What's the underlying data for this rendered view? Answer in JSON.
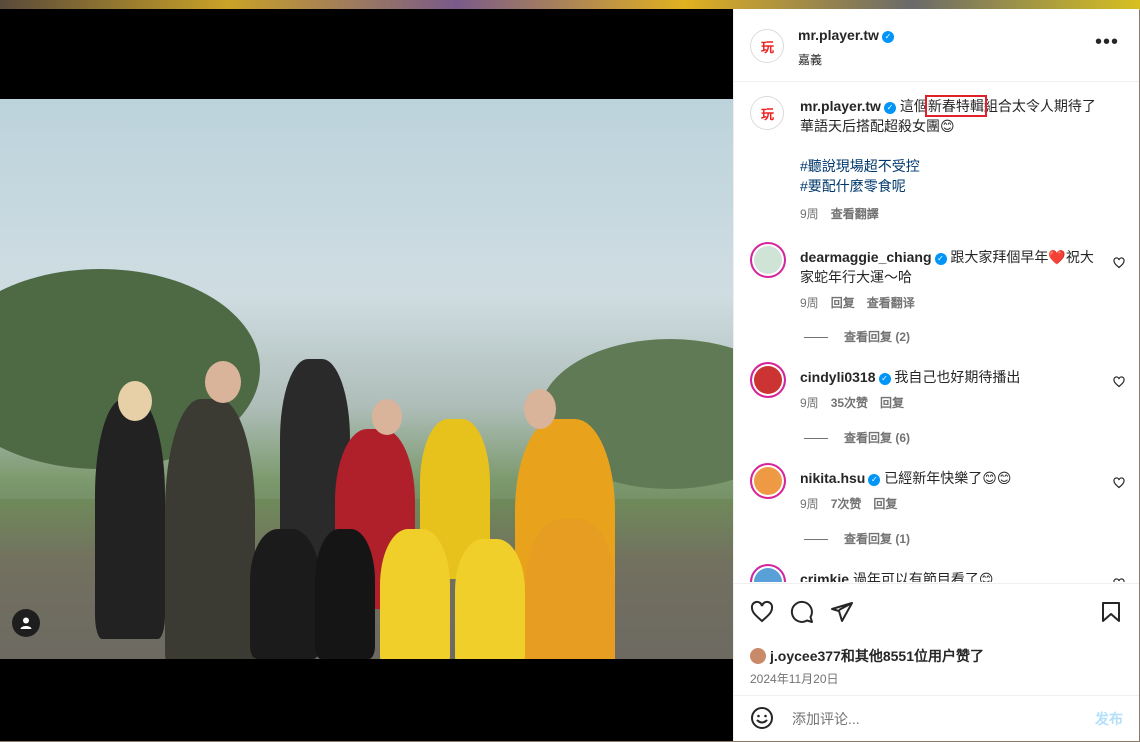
{
  "post": {
    "username": "mr.player.tw",
    "location": "嘉義",
    "avatar_text": "玩",
    "caption": {
      "prefix": "這個",
      "highlight": "新春特輯",
      "rest": "組合太令人期待了",
      "line2": "華語天后搭配超殺女團😊",
      "hashtag1": "#聽說現場超不受控",
      "hashtag2": "#要配什麼零食呢",
      "age": "9周",
      "translate": "查看翻譯"
    },
    "likes_text": "j.oycee377和其他8551位用户赞了",
    "date": "2024年11月20日"
  },
  "comments": [
    {
      "user": "dearmaggie_chiang",
      "verified": true,
      "text": "跟大家拜個早年❤️祝大家蛇年行大運～哈",
      "age": "9周",
      "reply": "回复",
      "translate": "查看翻译",
      "replies": "查看回复 (2)"
    },
    {
      "user": "cindyli0318",
      "verified": true,
      "text": "我自己也好期待播出",
      "age": "9周",
      "likes": "35次赞",
      "reply": "回复",
      "replies": "查看回复 (6)"
    },
    {
      "user": "nikita.hsu",
      "verified": true,
      "text": "已經新年快樂了😊😊",
      "age": "9周",
      "likes": "7次赞",
      "reply": "回复",
      "replies": "查看回复 (1)"
    },
    {
      "user": "crimkie",
      "verified": false,
      "text": "過年可以有節目看了😊"
    }
  ],
  "composer": {
    "placeholder": "添加评论...",
    "post_label": "发布"
  },
  "icons": [
    "more-icon",
    "heart-icon",
    "comment-icon",
    "share-icon",
    "save-icon",
    "emoji-icon",
    "user-tag-icon"
  ],
  "colors": {
    "link": "#00376b",
    "verified": "#0095f6",
    "highlight_box": "#e0202a",
    "post_disabled": "#b2dffc"
  }
}
